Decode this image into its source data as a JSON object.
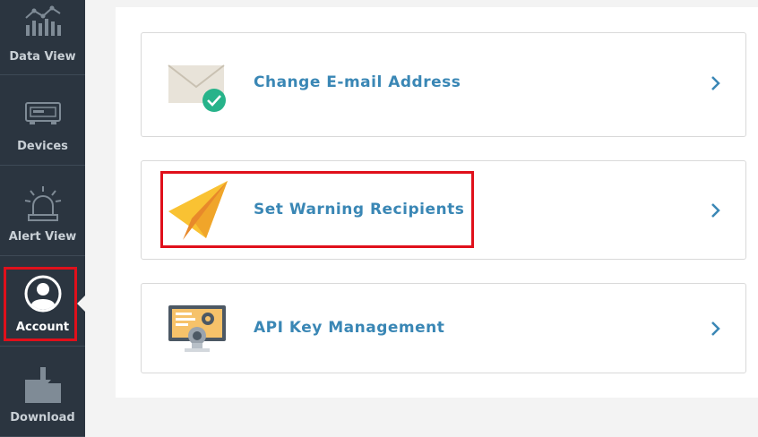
{
  "sidebar": {
    "items": [
      {
        "label": "Data View",
        "icon": "bar-chart-icon"
      },
      {
        "label": "Devices",
        "icon": "device-icon"
      },
      {
        "label": "Alert View",
        "icon": "alarm-light-icon"
      },
      {
        "label": "Account",
        "icon": "user-avatar-icon",
        "active": true
      },
      {
        "label": "Download",
        "icon": "download-folder-icon"
      }
    ]
  },
  "main": {
    "cards": [
      {
        "label": "Change E-mail Address",
        "icon": "envelope-check-icon"
      },
      {
        "label": "Set Warning Recipients",
        "icon": "paper-plane-icon"
      },
      {
        "label": "API Key Management",
        "icon": "computer-settings-icon"
      }
    ]
  },
  "colors": {
    "sidebar_bg": "#2b3540",
    "accent_text": "#3a87b5",
    "highlight": "#e0101b",
    "check_green": "#27b38a",
    "plane_yellow": "#f9c233"
  }
}
